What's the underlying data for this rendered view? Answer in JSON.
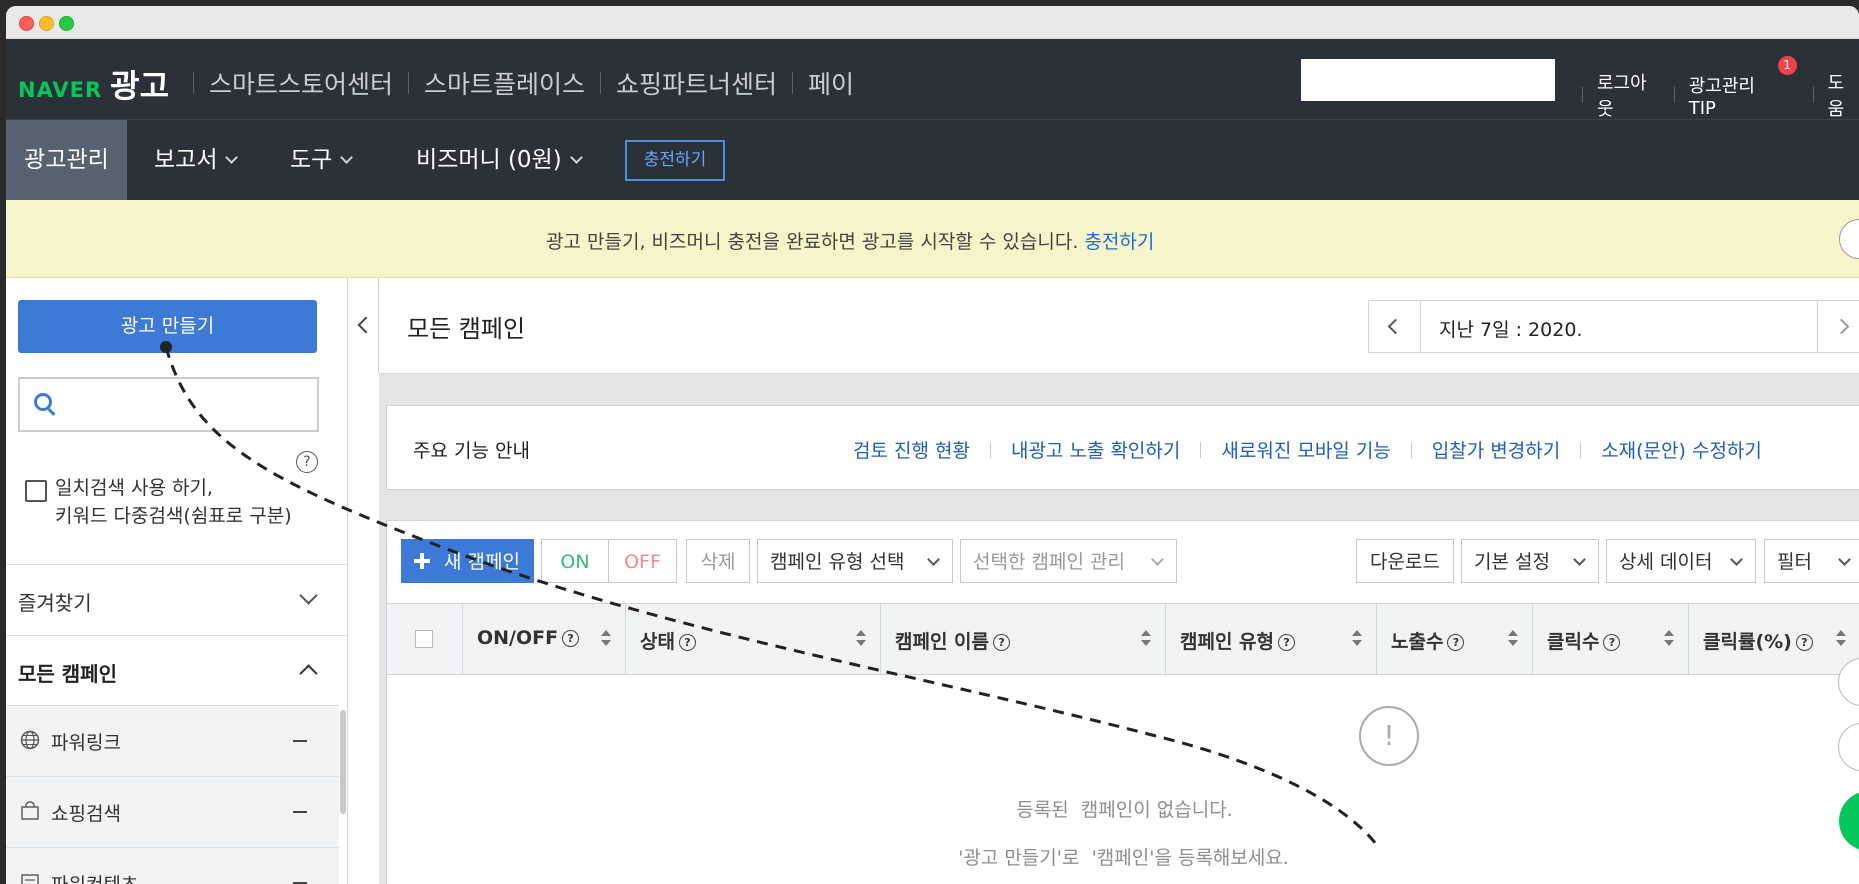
{
  "topnav": {
    "brand_naver": "NAVER",
    "brand_title": "광고",
    "site_links": [
      "스마트스토어센터",
      "스마트플레이스",
      "쇼핑파트너센터",
      "페이"
    ],
    "logout": "로그아웃",
    "tip": "광고관리 TIP",
    "tip_badge": "1",
    "help": "도움"
  },
  "subnav": {
    "manage": "광고관리",
    "report": "보고서",
    "tools": "도구",
    "bizmoney": "비즈머니 (0원)",
    "charge": "충전하기"
  },
  "notice": {
    "message": "광고 만들기, 비즈머니 충전을 완료하면 광고를 시작할 수 있습니다.",
    "link": "충전하기"
  },
  "sidebar": {
    "create_button": "광고 만들기",
    "help_mark": "?",
    "exact_line1": "일치검색 사용 하기,",
    "exact_line2": "키워드 다중검색(쉼표로 구분)",
    "favorites": "즐겨찾기",
    "all_campaigns": "모든 캠페인",
    "types": [
      "파워링크",
      "쇼핑검색",
      "파워컨텐츠"
    ]
  },
  "main": {
    "title": "모든 캠페인",
    "date_range": "지난 7일 :  2020.",
    "feature_title": "주요 기능 안내",
    "feature_links": [
      "검토 진행 현황",
      "내광고 노출 확인하기",
      "새로워진 모바일 기능",
      "입찰가 변경하기",
      "소재(문안) 수정하기"
    ],
    "toolbar": {
      "new_campaign": "새 캠페인",
      "on": "ON",
      "off": "OFF",
      "delete": "삭제",
      "type_select": "캠페인 유형 선택",
      "selected_manage": "선택한 캠페인 관리",
      "download": "다운로드",
      "basic_settings": "기본 설정",
      "detail_data": "상세 데이터",
      "filter": "필터"
    },
    "columns": [
      "ON/OFF",
      "상태",
      "캠페인 이름",
      "캠페인 유형",
      "노출수",
      "클릭수",
      "클릭률(%)"
    ],
    "empty_icon": "!",
    "empty_line1a": "등록된",
    "empty_line1b": "캠페인이 없습니다.",
    "empty_line2a": "'광고 만들기'로",
    "empty_line2b": "'캠페인'을 등록해보세요."
  },
  "colors": {
    "header_bg": "#2b3138",
    "brand_green": "#03c75a",
    "primary_blue": "#3d7ad8",
    "notice_bg": "#f6f4c8"
  }
}
